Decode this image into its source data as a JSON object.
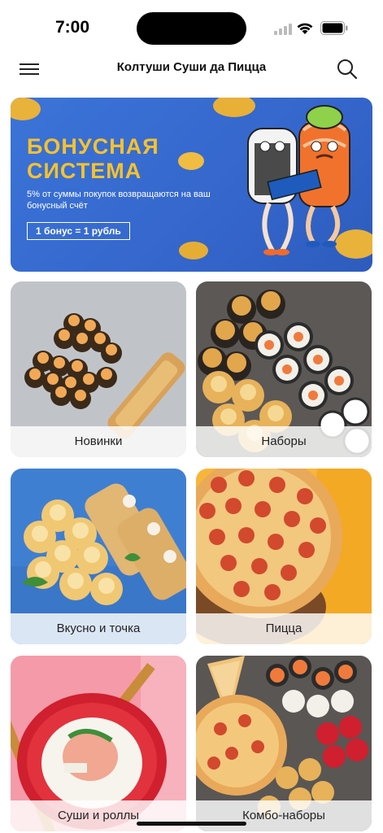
{
  "status": {
    "time": "7:00"
  },
  "header": {
    "title": "Колтуши Суши да Пицца"
  },
  "banner": {
    "title": "БОНУСНАЯ СИСТЕМА",
    "text": "5%  от суммы покупок возвращаются на ваш бонусный счёт",
    "badge": "1 бонус = 1 рубль"
  },
  "categories": [
    {
      "label": "Новинки"
    },
    {
      "label": "Наборы"
    },
    {
      "label": "Вкусно и точка"
    },
    {
      "label": "Пицца"
    },
    {
      "label": "Суши и роллы"
    },
    {
      "label": "Комбо-наборы"
    }
  ],
  "colors": {
    "accent": "#f6c22c",
    "banner_bg": "#3b74d8"
  }
}
